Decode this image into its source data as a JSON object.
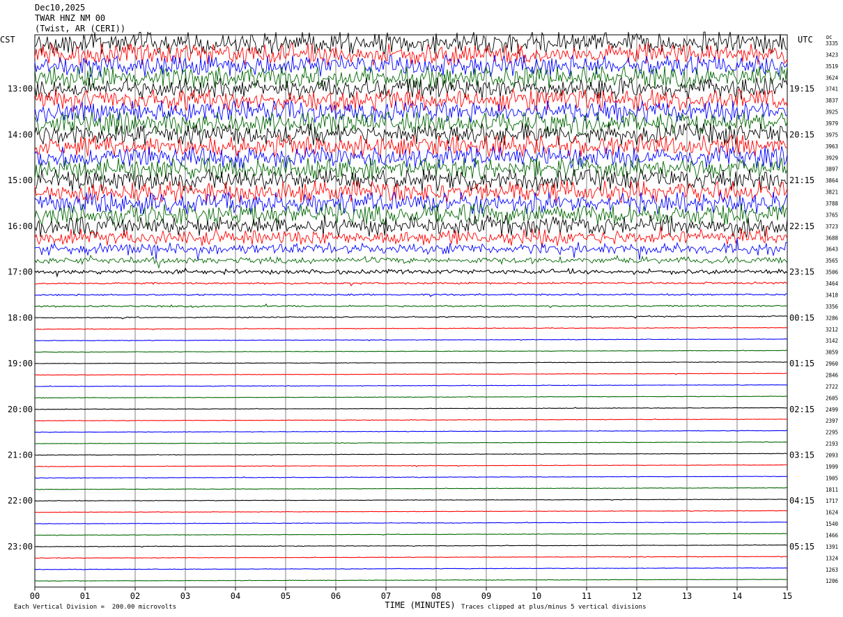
{
  "header": {
    "date": "Dec10,2025",
    "station": "TWAR HNZ NM 00",
    "location": "(Twist, AR (CERI))"
  },
  "left_tz": "CST",
  "right_tz": "UTC",
  "dc_label": "DC",
  "footer": {
    "scale": "Each Vertical Division =  200.00 microvolts",
    "clip": "Traces clipped at plus/minus 5 vertical divisions"
  },
  "colors": {
    "trace_cycle": [
      "#000000",
      "#ff0000",
      "#0000ff",
      "#006600"
    ],
    "grid": "#808080"
  },
  "chart_data": {
    "type": "line",
    "title": "TWAR HNZ NM 00",
    "xlabel": "TIME (MINUTES)",
    "ylabel": "",
    "x_ticks": [
      "00",
      "01",
      "02",
      "03",
      "04",
      "05",
      "06",
      "07",
      "08",
      "09",
      "10",
      "11",
      "12",
      "13",
      "14",
      "15"
    ],
    "xlim": [
      0,
      15
    ],
    "left_hour_labels": [
      "13:00",
      "14:00",
      "15:00",
      "16:00",
      "17:00",
      "18:00",
      "19:00",
      "20:00",
      "21:00",
      "22:00",
      "23:00"
    ],
    "right_hour_labels": [
      "19:15",
      "20:15",
      "21:15",
      "22:15",
      "23:15",
      "00:15",
      "01:15",
      "02:15",
      "03:15",
      "04:15",
      "05:15"
    ],
    "dc_offsets": [
      3335,
      3423,
      3519,
      3624,
      3741,
      3837,
      3925,
      3979,
      3975,
      3963,
      3929,
      3897,
      3864,
      3821,
      3788,
      3765,
      3723,
      3688,
      3643,
      3565,
      3506,
      3464,
      3418,
      3356,
      3286,
      3212,
      3142,
      3059,
      2960,
      2846,
      2722,
      2605,
      2499,
      2397,
      2295,
      2193,
      2093,
      1999,
      1905,
      1811,
      1717,
      1624,
      1540,
      1466,
      1391,
      1324,
      1263,
      1206
    ],
    "amplitude_divisions": [
      5,
      5,
      5,
      5,
      5,
      5,
      5,
      5,
      5,
      5,
      5,
      5,
      5,
      5,
      5,
      5,
      4.5,
      3.5,
      2.5,
      1.5,
      1.0,
      0.45,
      0.35,
      0.35,
      0.25,
      0.15,
      0.12,
      0.12,
      0.12,
      0.12,
      0.12,
      0.12,
      0.12,
      0.12,
      0.12,
      0.12,
      0.12,
      0.12,
      0.12,
      0.12,
      0.12,
      0.12,
      0.12,
      0.12,
      0.12,
      0.12,
      0.12,
      0.12
    ]
  }
}
